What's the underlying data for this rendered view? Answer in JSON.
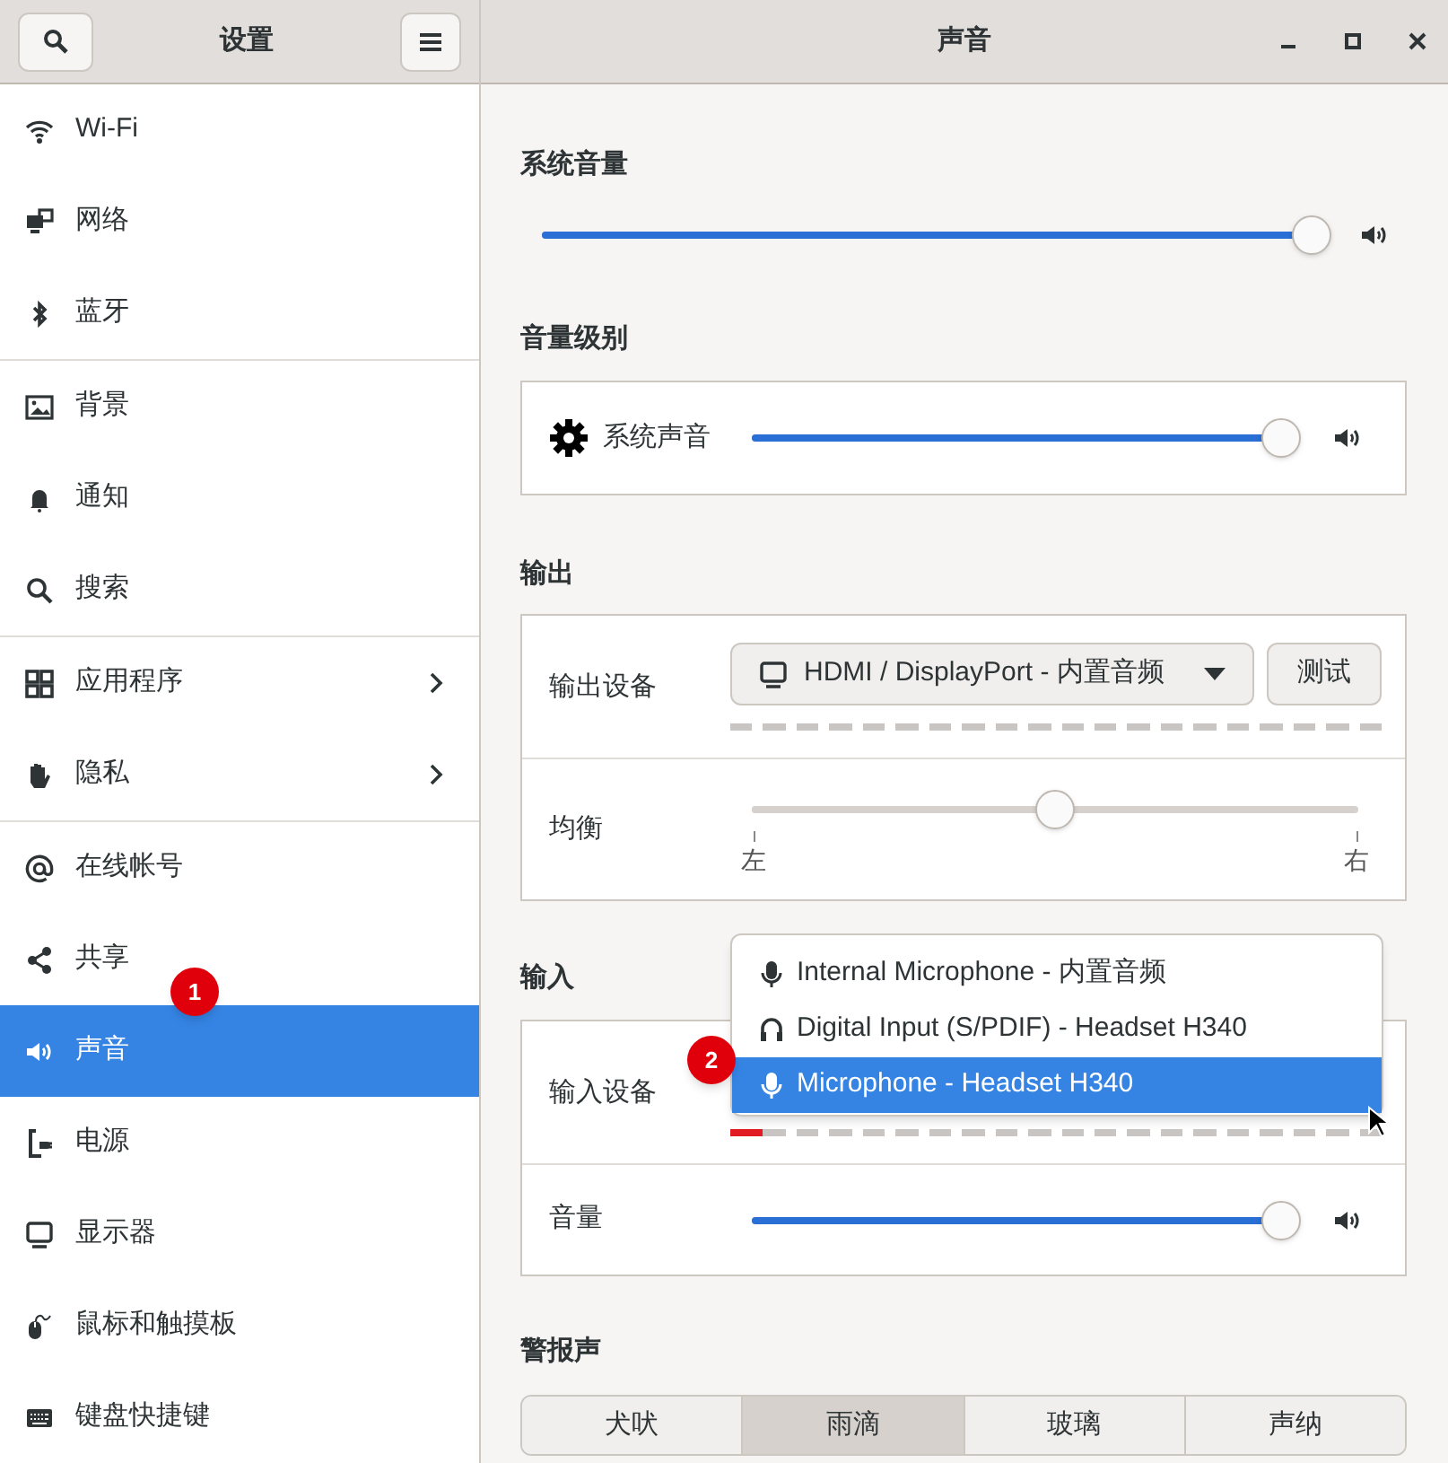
{
  "sidebar": {
    "title": "设置",
    "groups": [
      {
        "items": [
          {
            "label": "Wi-Fi",
            "selected": false,
            "submenu": false
          },
          {
            "label": "网络",
            "selected": false,
            "submenu": false
          },
          {
            "label": "蓝牙",
            "selected": false,
            "submenu": false
          }
        ]
      },
      {
        "items": [
          {
            "label": "背景",
            "selected": false,
            "submenu": false
          },
          {
            "label": "通知",
            "selected": false,
            "submenu": false
          },
          {
            "label": "搜索",
            "selected": false,
            "submenu": false
          }
        ]
      },
      {
        "items": [
          {
            "label": "应用程序",
            "selected": false,
            "submenu": true
          },
          {
            "label": "隐私",
            "selected": false,
            "submenu": true
          }
        ]
      },
      {
        "items": [
          {
            "label": "在线帐号",
            "selected": false,
            "submenu": false
          },
          {
            "label": "共享",
            "selected": false,
            "submenu": false
          },
          {
            "label": "声音",
            "selected": true,
            "submenu": false
          },
          {
            "label": "电源",
            "selected": false,
            "submenu": false
          },
          {
            "label": "显示器",
            "selected": false,
            "submenu": false
          },
          {
            "label": "鼠标和触摸板",
            "selected": false,
            "submenu": false
          },
          {
            "label": "键盘快捷键",
            "selected": false,
            "submenu": false
          }
        ]
      }
    ]
  },
  "window": {
    "title": "声音"
  },
  "system_volume": {
    "heading": "系统音量",
    "level": 1
  },
  "volume_levels": {
    "heading": "音量级别",
    "rows": [
      {
        "label": "系统声音",
        "level": 1
      }
    ]
  },
  "output": {
    "heading": "输出",
    "device_label": "输出设备",
    "device": "HDMI / DisplayPort - 内置音频",
    "test_button": "测试",
    "meter": {
      "level": 0
    },
    "balance": {
      "label": "均衡",
      "level": 0.5,
      "left": "左",
      "right": "右"
    }
  },
  "input": {
    "heading": "输入",
    "device_label": "输入设备",
    "meter": {
      "level": 0.05
    },
    "volume": {
      "label": "音量",
      "level": 1
    },
    "dropdown": [
      {
        "label": "Internal Microphone - 内置音频",
        "kind": "microphone",
        "selected": false
      },
      {
        "label": "Digital Input (S/PDIF) - Headset H340",
        "kind": "headset",
        "selected": false
      },
      {
        "label": "Microphone - Headset H340",
        "kind": "microphone",
        "selected": true
      }
    ]
  },
  "alert_sound": {
    "heading": "警报声",
    "options": [
      {
        "label": "犬吠",
        "selected": false
      },
      {
        "label": "雨滴",
        "selected": true
      },
      {
        "label": "玻璃",
        "selected": false
      },
      {
        "label": "声纳",
        "selected": false
      }
    ]
  },
  "annotations": [
    {
      "label": "1"
    },
    {
      "label": "2"
    }
  ]
}
